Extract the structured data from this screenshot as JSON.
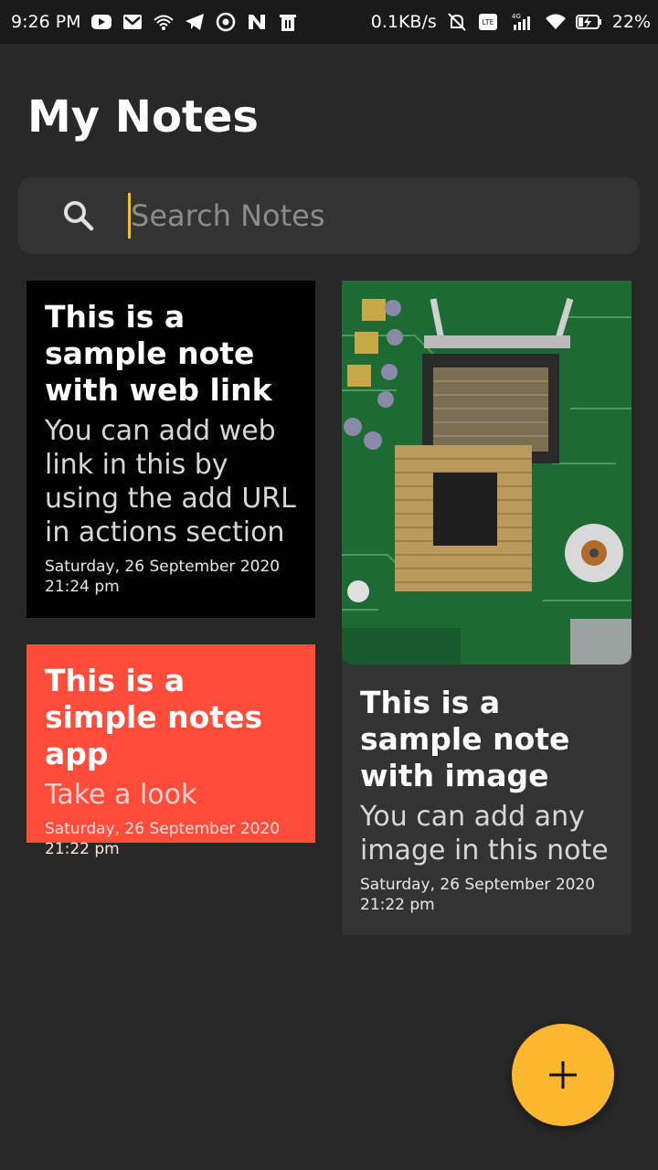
{
  "status_bar": {
    "time": "9:26 PM",
    "net_speed": "0.1KB/s",
    "network_type": "4G",
    "battery": "22%",
    "icons_left": [
      "youtube-icon",
      "gmail-icon",
      "wifi-hotspot-icon",
      "telegram-icon",
      "whatsapp-icon",
      "n-app-icon",
      "delete-icon"
    ],
    "icons_right": [
      "alarm-off-icon",
      "volte-icon",
      "signal-icon",
      "wifi-icon",
      "battery-charging-icon"
    ]
  },
  "header": {
    "title": "My Notes"
  },
  "search": {
    "placeholder": "Search Notes",
    "value": ""
  },
  "notes": [
    {
      "title": "This is a sample note with web link",
      "subtitle": "You can add web link in this by using the add URL in actions section",
      "date": "Saturday, 26 September 2020",
      "time": "21:24 pm",
      "color": "#000000"
    },
    {
      "title": "This is a simple notes app",
      "subtitle": "Take a look",
      "date": "Saturday, 26 September 2020",
      "time": "21:22 pm",
      "color": "#ff4c3b"
    },
    {
      "title": "This is a sample note with image",
      "subtitle": "You can add any image in this note",
      "date": "Saturday, 26 September 2020",
      "time": "21:22 pm",
      "color": "#333333",
      "image": "motherboard-cpu-socket-photo"
    }
  ],
  "fab": {
    "icon": "plus-icon",
    "color": "#fbb72f"
  },
  "colors": {
    "background": "#282828",
    "accent": "#fbb72f"
  }
}
